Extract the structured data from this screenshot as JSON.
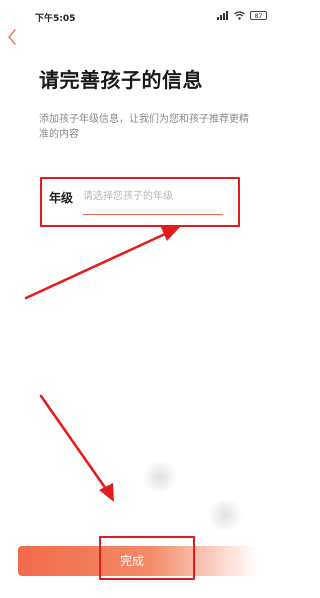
{
  "status_bar": {
    "time": "下午5:05",
    "battery": "87",
    "icons": [
      "signal-icon",
      "wifi-icon",
      "battery-icon"
    ]
  },
  "header": {
    "back_icon": "chevron-left-icon",
    "title": "请完善孩子的信息"
  },
  "description": "添加孩子年级信息，让我们为您和孩子推荐更精准的内容",
  "form": {
    "grade_label": "年级",
    "grade_value": "",
    "grade_placeholder": "请选择您孩子的年级"
  },
  "footer": {
    "done_label": "完成"
  },
  "colors": {
    "accent": "#f26a4b",
    "annotation": "#e11d1d",
    "back_icon": "#e8805f"
  }
}
